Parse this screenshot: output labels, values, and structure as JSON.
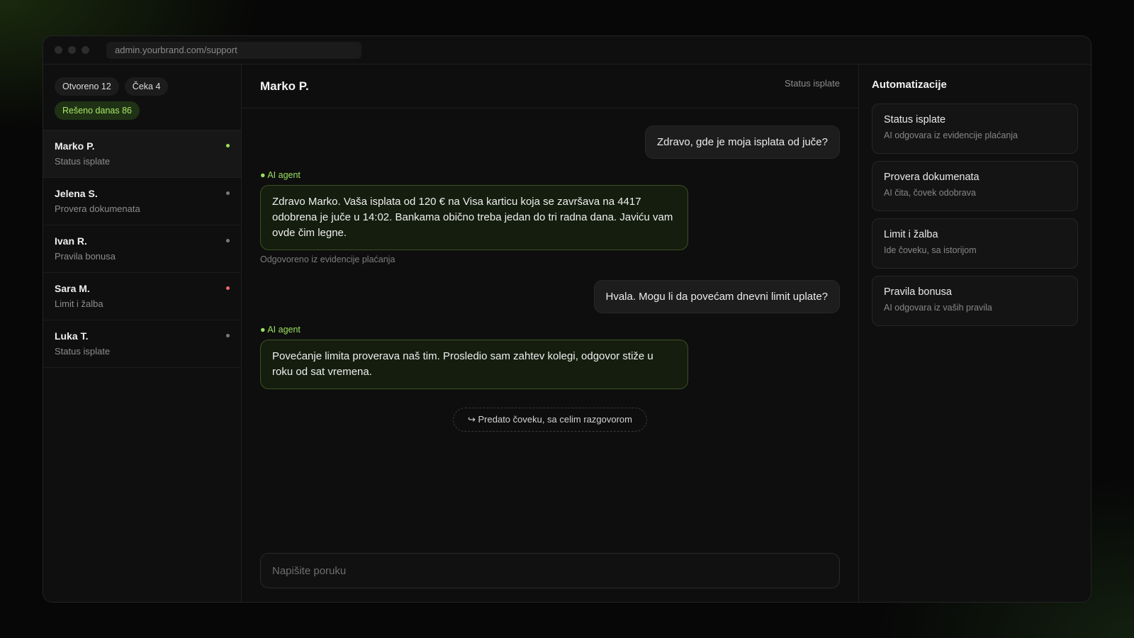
{
  "browser": {
    "url": "admin.yourbrand.com/support"
  },
  "sidebar": {
    "chips": [
      {
        "label": "Otvoreno 12"
      },
      {
        "label": "Čeka 4"
      },
      {
        "label": "Rešeno danas 86"
      }
    ],
    "conversations": [
      {
        "name": "Marko P.",
        "topic": "Status isplate",
        "status": "green"
      },
      {
        "name": "Jelena S.",
        "topic": "Provera dokumenata",
        "status": "gray"
      },
      {
        "name": "Ivan R.",
        "topic": "Pravila bonusa",
        "status": "gray"
      },
      {
        "name": "Sara M.",
        "topic": "Limit i žalba",
        "status": "red"
      },
      {
        "name": "Luka T.",
        "topic": "Status isplate",
        "status": "gray"
      }
    ]
  },
  "chat": {
    "title": "Marko P.",
    "status": "Status isplate",
    "messages": [
      {
        "role": "user",
        "text": "Zdravo, gde je moja isplata od juče?"
      },
      {
        "role": "ai",
        "tag": "● AI agent",
        "text": "Zdravo Marko. Vaša isplata od 120 € na Visa karticu koja se završava na 4417 odobrena je juče u 14:02. Bankama obično treba jedan do tri radna dana. Javiću vam ovde čim legne.",
        "meta": "Odgovoreno iz evidencije plaćanja"
      },
      {
        "role": "user",
        "text": "Hvala. Mogu li da povećam dnevni limit uplate?"
      },
      {
        "role": "ai",
        "tag": "● AI agent",
        "text": "Povećanje limita proverava naš tim. Prosledio sam zahtev kolegi, odgovor stiže u roku od sat vremena."
      }
    ],
    "handoff": "↪ Predato čoveku, sa celim razgovorom",
    "composer_placeholder": "Napišite poruku"
  },
  "automations": {
    "title": "Automatizacije",
    "items": [
      {
        "title": "Status isplate",
        "desc": "AI odgovara iz evidencije plaćanja"
      },
      {
        "title": "Provera dokumenata",
        "desc": "AI čita, čovek odobrava"
      },
      {
        "title": "Limit i žalba",
        "desc": "Ide čoveku, sa istorijom"
      },
      {
        "title": "Pravila bonusa",
        "desc": "AI odgovara iz vaših pravila"
      }
    ]
  },
  "colors": {
    "accent": "#9be15d",
    "ai_bubble_border": "#3a5322",
    "status_red": "#ef6a6a"
  }
}
